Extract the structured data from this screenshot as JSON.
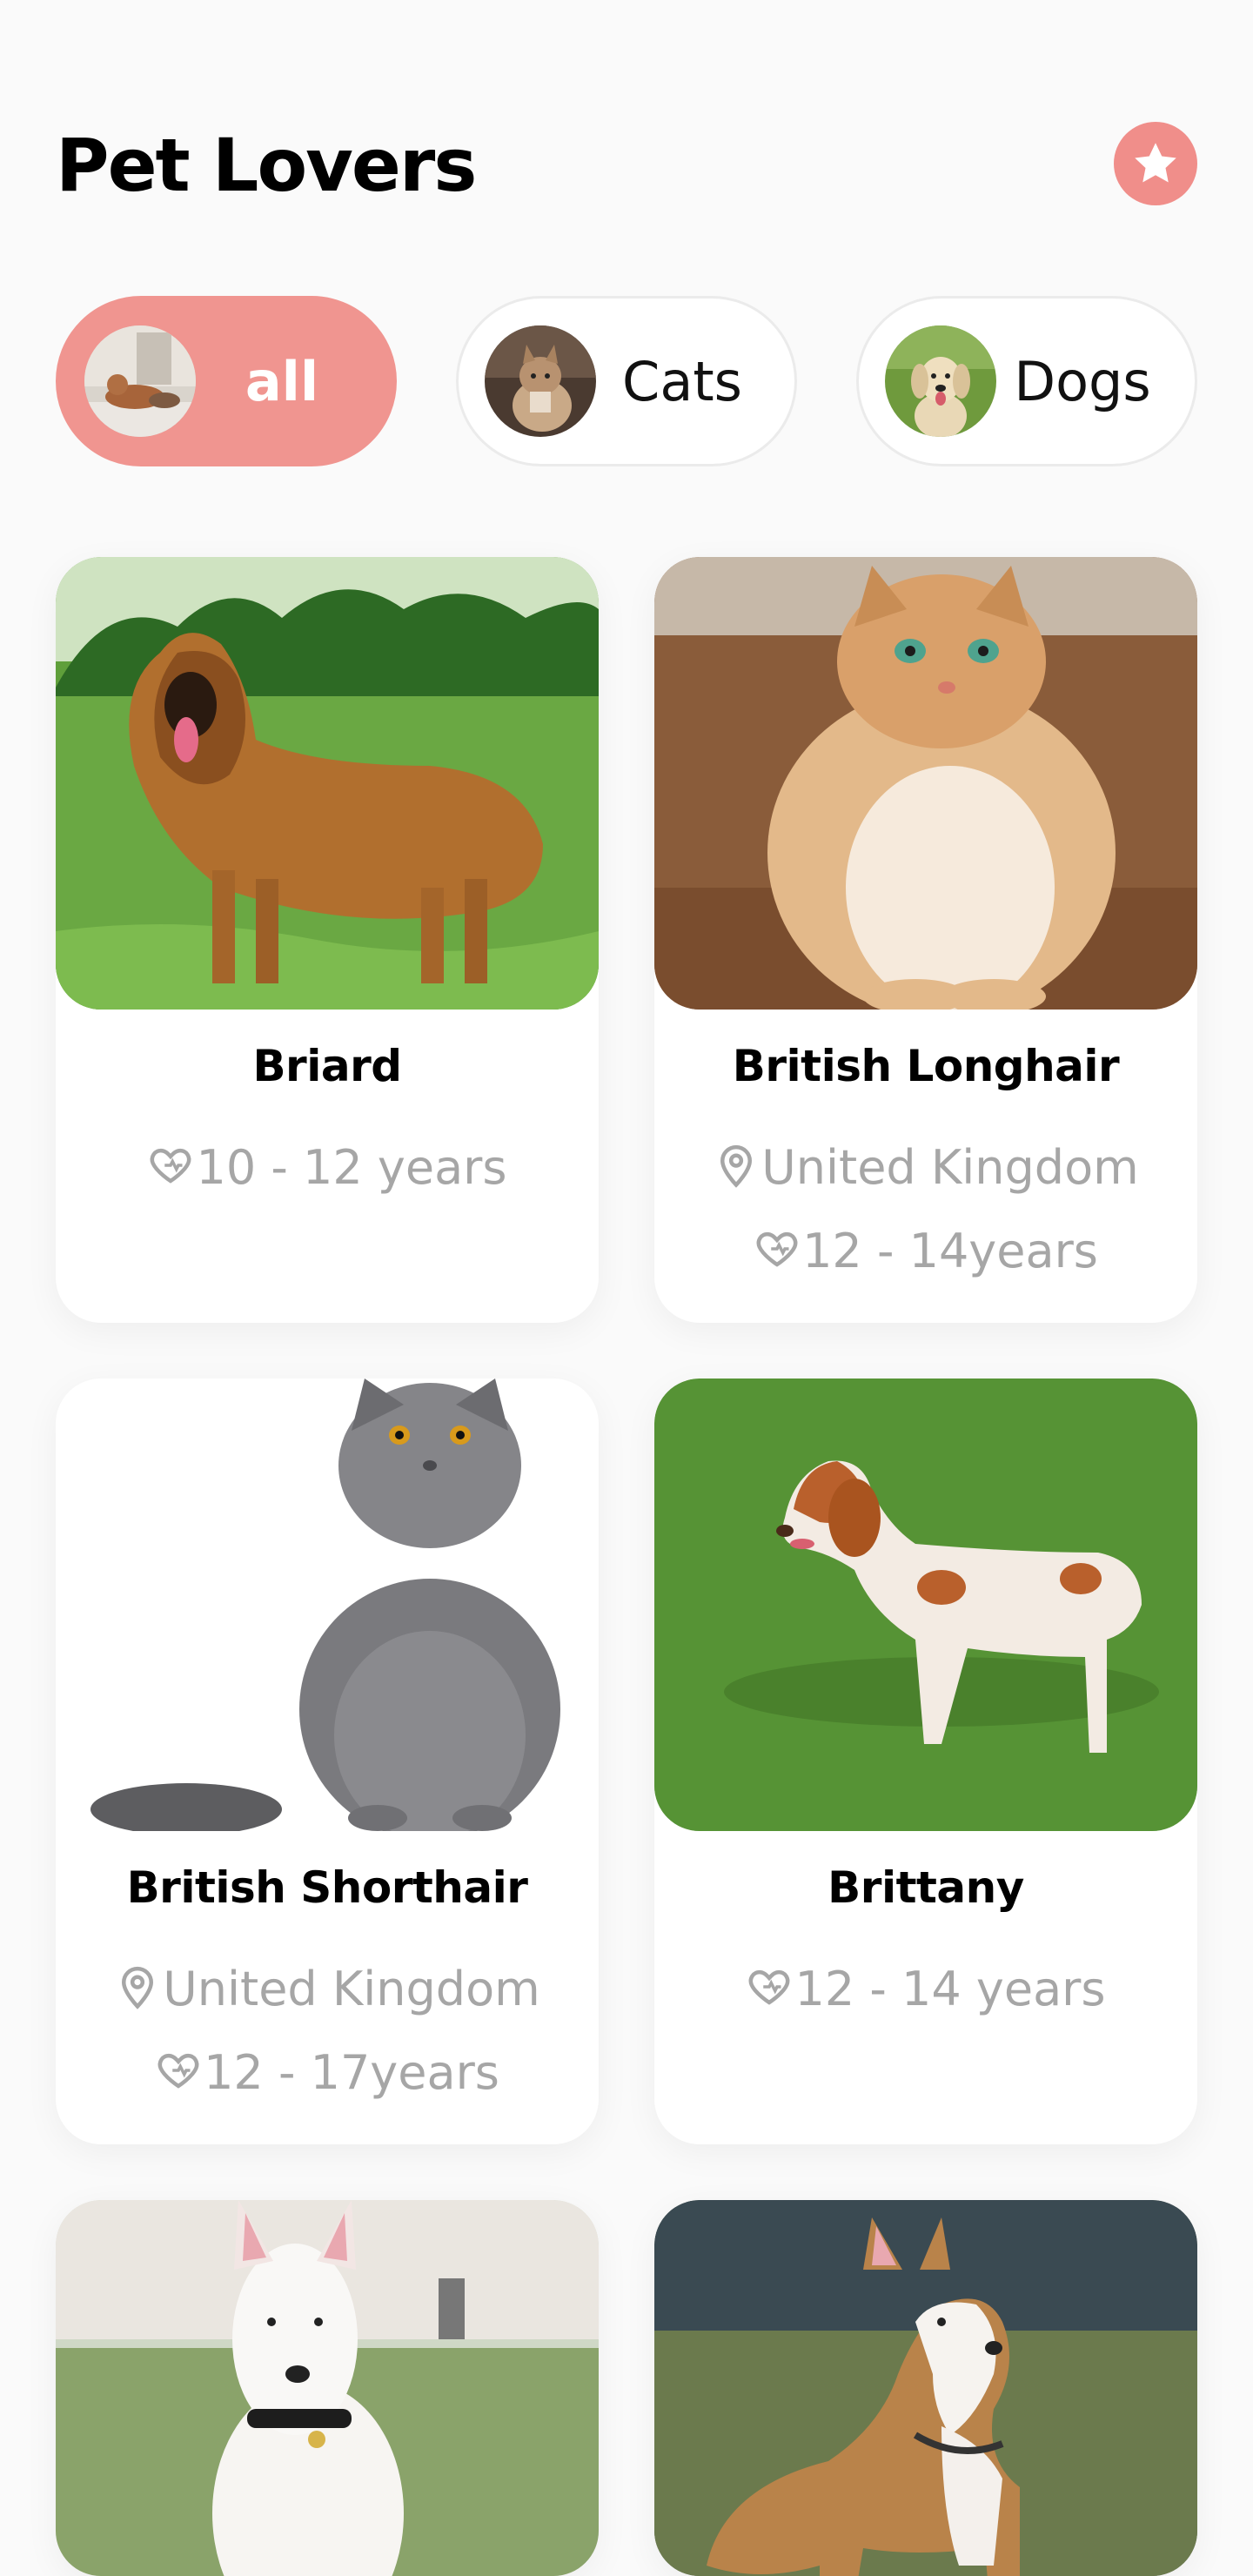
{
  "header": {
    "title": "Pet Lovers",
    "favorite_icon": "star-icon",
    "accent": "#f08e8a"
  },
  "filters": [
    {
      "label": "all",
      "icon": "all-pets-avatar",
      "active": true
    },
    {
      "label": "Cats",
      "icon": "cat-avatar",
      "active": false
    },
    {
      "label": "Dogs",
      "icon": "dog-avatar",
      "active": false
    }
  ],
  "cards": [
    {
      "name": "Briard",
      "origin": "",
      "lifespan": "10 - 12 years",
      "type": "dog"
    },
    {
      "name": "British Longhair",
      "origin": "United Kingdom",
      "lifespan": "12 - 14years",
      "type": "cat"
    },
    {
      "name": "British Shorthair",
      "origin": "United Kingdom",
      "lifespan": "12 - 17years",
      "type": "cat"
    },
    {
      "name": "Brittany",
      "origin": "",
      "lifespan": "12 - 14 years",
      "type": "dog"
    },
    {
      "name": "",
      "origin": "",
      "lifespan": "",
      "type": "dog"
    },
    {
      "name": "",
      "origin": "",
      "lifespan": "",
      "type": "dog"
    }
  ],
  "icons": {
    "location": "location-pin-icon",
    "lifespan": "heart-icon"
  }
}
